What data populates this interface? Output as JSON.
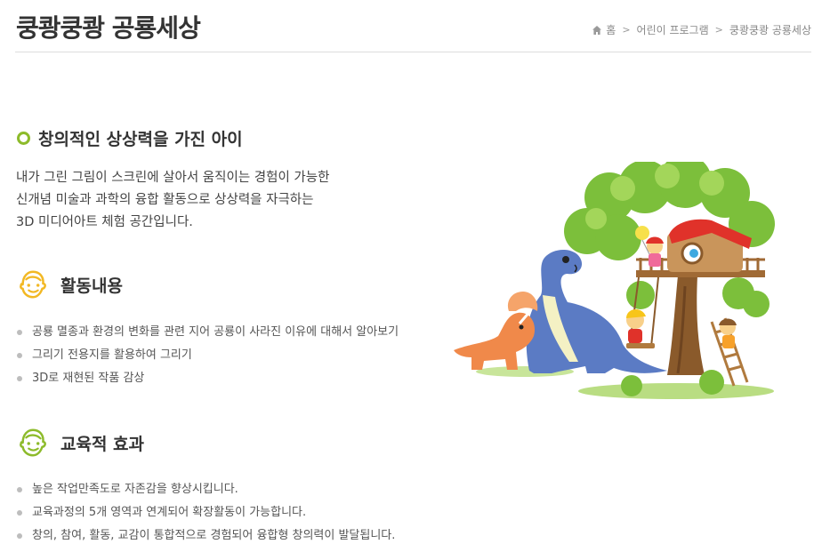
{
  "header": {
    "title": "쿵쾅쿵쾅 공룡세상",
    "breadcrumb": {
      "home_icon": "home-icon",
      "home_label": "홈",
      "items": [
        "어린이 프로그램",
        "쿵쾅쿵쾅 공룡세상"
      ]
    }
  },
  "section": {
    "title": "창의적인 상상력을 가진 아이",
    "intro_lines": [
      "내가 그린 그림이 스크린에 살아서 움직이는 경험이 가능한",
      "신개념 미술과 과학의 융합 활동으로 상상력을 자극하는",
      "3D 미디어아트 체험 공간입니다."
    ]
  },
  "activity": {
    "title": "활동내용",
    "icon": "smiley-face-icon",
    "icon_color": "#f2b824",
    "items": [
      "공룡 멸종과 환경의 변화를 관련 지어 공룡이 사라진 이유에 대해서 알아보기",
      "그리기 전용지를 활용하여 그리기",
      "3D로 재현된 작품 감상"
    ]
  },
  "effect": {
    "title": "교육적 효과",
    "icon": "smiley-face-icon",
    "icon_color": "#8dbb2b",
    "items": [
      "높은 작업만족도로 자존감을 향상시킵니다.",
      "교육과정의 5개 영역과 연계되어 확장활동이 가능합니다.",
      "창의, 참여, 활동, 교감이 통합적으로 경험되어 융합형 창의력이 발달됩니다."
    ]
  },
  "illustration": {
    "icon": "dinosaur-treehouse-illustration",
    "colors": {
      "leaves": "#7cbf3b",
      "trunk": "#8a5a2b",
      "roof": "#e0322a",
      "dino_blue": "#5b7bc4",
      "dino_orange": "#f0894a"
    }
  }
}
